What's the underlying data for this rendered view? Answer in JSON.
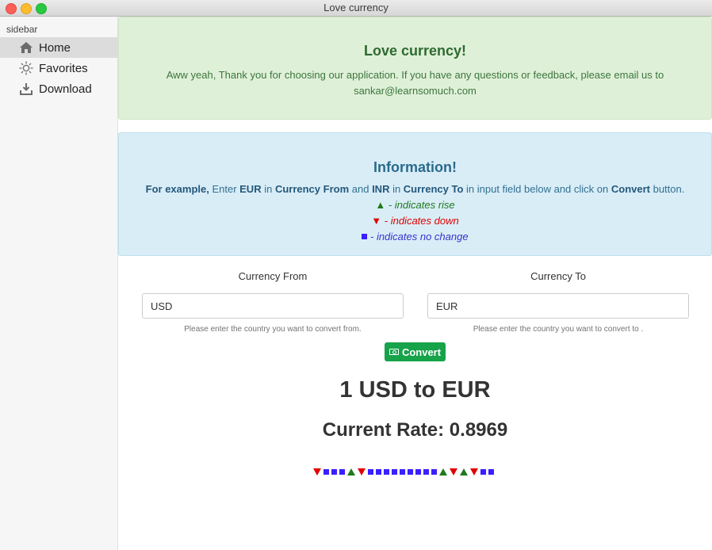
{
  "window": {
    "title": "Love currency"
  },
  "sidebar": {
    "heading": "sidebar",
    "items": [
      {
        "label": "Home",
        "icon": "home-icon",
        "active": true
      },
      {
        "label": "Favorites",
        "icon": "sun-icon",
        "active": false
      },
      {
        "label": "Download",
        "icon": "download-icon",
        "active": false
      }
    ]
  },
  "welcome": {
    "title": "Love currency!",
    "message": "Aww yeah, Thank you for choosing our application. If you have any questions or feedback, please email us to sankar@learnsomuch.com"
  },
  "info": {
    "title": "Information!",
    "example_lead": "For example,",
    "enter": " Enter ",
    "from_code": "EUR",
    "in1": " in ",
    "from_field": "Currency From",
    "and": " and ",
    "to_code": "INR",
    "in2": " in ",
    "to_field": "Currency To",
    "rest": " in input field below and click on ",
    "button_name": "Convert",
    "tail": " button.",
    "rise_text": " - indicates rise",
    "down_text": " - indicates down",
    "same_text": " - indicates no change"
  },
  "form": {
    "from_label": "Currency From",
    "from_value": "USD",
    "from_help": "Please enter the country you want to convert from.",
    "to_label": "Currency To",
    "to_value": "EUR",
    "to_help": "Please enter the country you want to convert to .",
    "convert_label": "Convert"
  },
  "result": {
    "pair": "1 USD to EUR",
    "rate_text": "Current Rate: 0.8969"
  },
  "history": [
    "down",
    "same",
    "same",
    "same",
    "rise",
    "down",
    "same",
    "same",
    "same",
    "same",
    "same",
    "same",
    "same",
    "same",
    "same",
    "rise",
    "down",
    "rise",
    "down",
    "same",
    "same"
  ],
  "colors": {
    "rise": "#1e7a1e",
    "down": "#e00000",
    "same": "#3a1fff",
    "success_bg": "#dff0d8",
    "info_bg": "#d9edf7",
    "button": "#16a34a"
  }
}
